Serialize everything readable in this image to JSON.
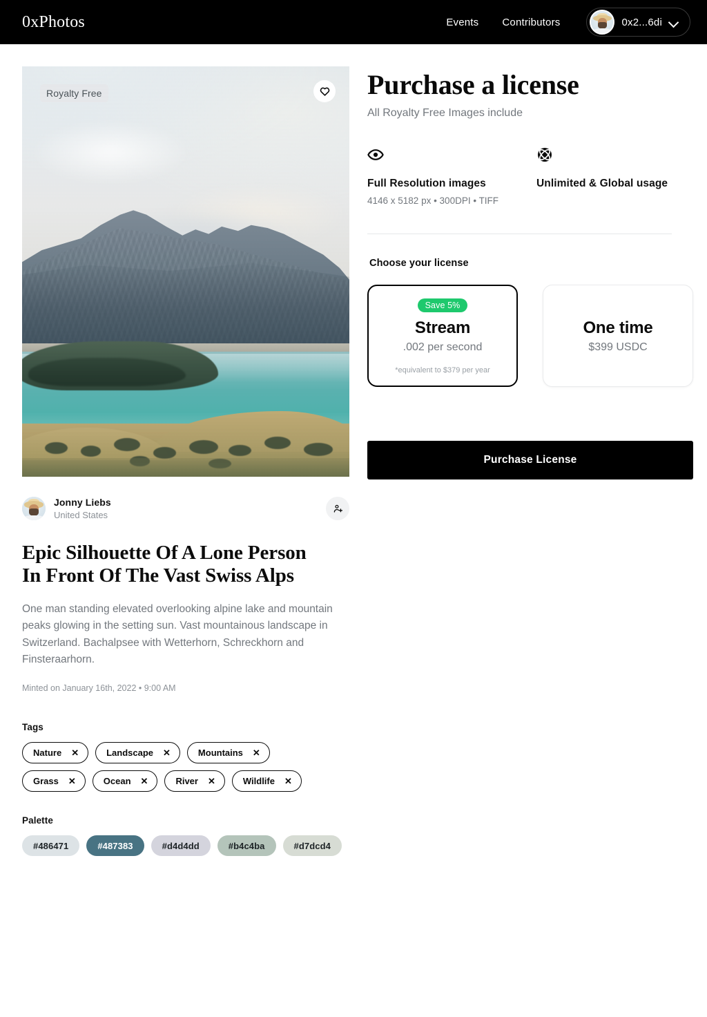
{
  "header": {
    "brand": "0xPhotos",
    "nav": [
      {
        "label": "Events"
      },
      {
        "label": "Contributors"
      }
    ],
    "wallet": {
      "address": "0x2...6di",
      "avatar_icon": "user-avatar",
      "chevron_icon": "chevron-down-icon"
    }
  },
  "photo": {
    "badge": "Royalty Free",
    "favorite_icon": "heart-icon"
  },
  "author": {
    "name": "Jonny Liebs",
    "country": "United States",
    "avatar_icon": "user-avatar",
    "follow_icon": "person-add-icon"
  },
  "details": {
    "title": "Epic Silhouette Of A Lone Person In Front Of The Vast Swiss Alps",
    "description": "One man standing elevated overlooking alpine lake and mountain peaks glowing in the setting sun. Vast mountainous landscape in Switzerland. Bachalpsee with Wetterhorn, Schreckhorn and Finsteraarhorn.",
    "minted": "Minted on January 16th, 2022 • 9:00 AM"
  },
  "tags": {
    "label": "Tags",
    "remove_icon": "close-icon",
    "items": [
      {
        "label": "Nature"
      },
      {
        "label": "Landscape"
      },
      {
        "label": "Mountains"
      },
      {
        "label": "Grass"
      },
      {
        "label": "Ocean"
      },
      {
        "label": "River"
      },
      {
        "label": "Wildlife"
      }
    ]
  },
  "palette": {
    "label": "Palette",
    "swatches": [
      {
        "hex": "#486471",
        "bg": "#dde3e6",
        "fg": "#1d2326"
      },
      {
        "hex": "#487383",
        "bg": "#487383",
        "fg": "#ffffff"
      },
      {
        "hex": "#d4d4dd",
        "bg": "#d4d4dd",
        "fg": "#1d2326"
      },
      {
        "hex": "#b4c4ba",
        "bg": "#b4c4ba",
        "fg": "#1d2326"
      },
      {
        "hex": "#d7dcd4",
        "bg": "#d7dcd4",
        "fg": "#1d2326"
      }
    ]
  },
  "purchase": {
    "title": "Purchase a license",
    "subtitle": "All Royalty Free Images include",
    "features": [
      {
        "icon": "eye-icon",
        "title": "Full Resolution images",
        "meta": "4146 x 5182 px  •  300DPI  •  TIFF"
      },
      {
        "icon": "globe-icon",
        "title": "Unlimited & Global usage",
        "meta": ""
      }
    ],
    "choose_label": "Choose your license",
    "licenses": [
      {
        "badge": "Save 5%",
        "name": "Stream",
        "price": ".002 per second",
        "note": "*equivalent to $379 per year",
        "selected": true
      },
      {
        "badge": "",
        "name": "One time",
        "price": "$399 USDC",
        "note": "",
        "selected": false
      }
    ],
    "cta": "Purchase License",
    "accent_green": "#1ec96d"
  }
}
